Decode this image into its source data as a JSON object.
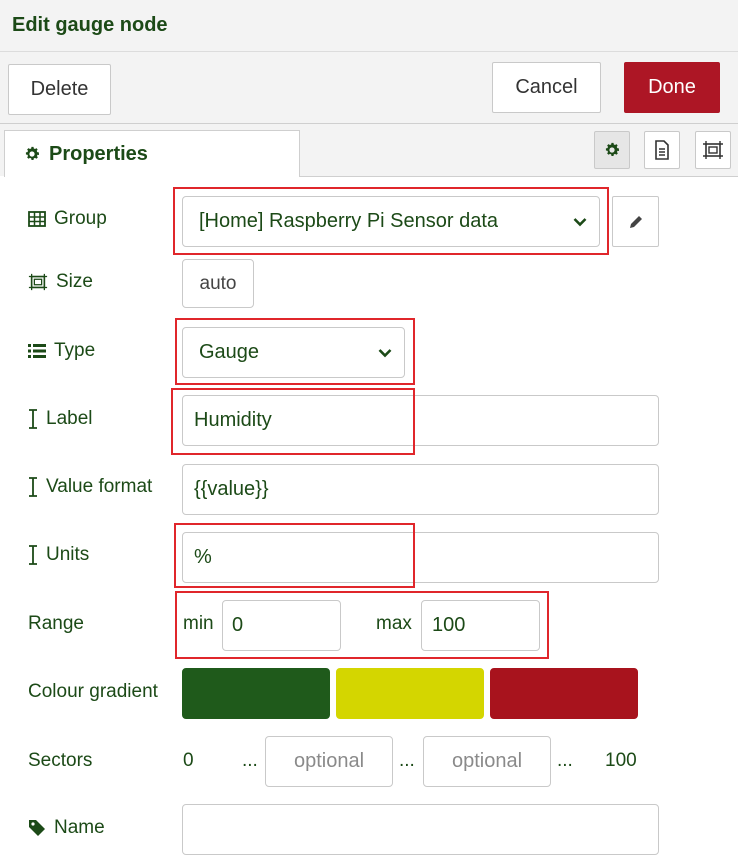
{
  "header": {
    "title": "Edit gauge node"
  },
  "toolbar": {
    "delete_label": "Delete",
    "cancel_label": "Cancel",
    "done_label": "Done"
  },
  "tabs": {
    "properties_label": "Properties"
  },
  "form": {
    "group": {
      "label": "Group",
      "value": "[Home] Raspberry Pi Sensor data"
    },
    "size": {
      "label": "Size",
      "value": "auto"
    },
    "type": {
      "label": "Type",
      "value": "Gauge"
    },
    "label_field": {
      "label": "Label",
      "value": "Humidity"
    },
    "value_format": {
      "label": "Value format",
      "value": "{{value}}"
    },
    "units": {
      "label": "Units",
      "value": "%"
    },
    "range": {
      "label": "Range",
      "min_label": "min",
      "min_value": "0",
      "max_label": "max",
      "max_value": "100"
    },
    "colour_gradient": {
      "label": "Colour gradient",
      "colors": [
        "#1f5a1b",
        "#d4d600",
        "#a8131d"
      ]
    },
    "sectors": {
      "label": "Sectors",
      "start": "0",
      "dots1": "...",
      "placeholder1": "optional",
      "dots2": "...",
      "placeholder2": "optional",
      "dots3": "...",
      "end": "100"
    },
    "name": {
      "label": "Name",
      "value": ""
    }
  },
  "colors": {
    "accent": "#1c4a17",
    "primary_button": "#ad1625",
    "highlight": "#e0262b"
  }
}
